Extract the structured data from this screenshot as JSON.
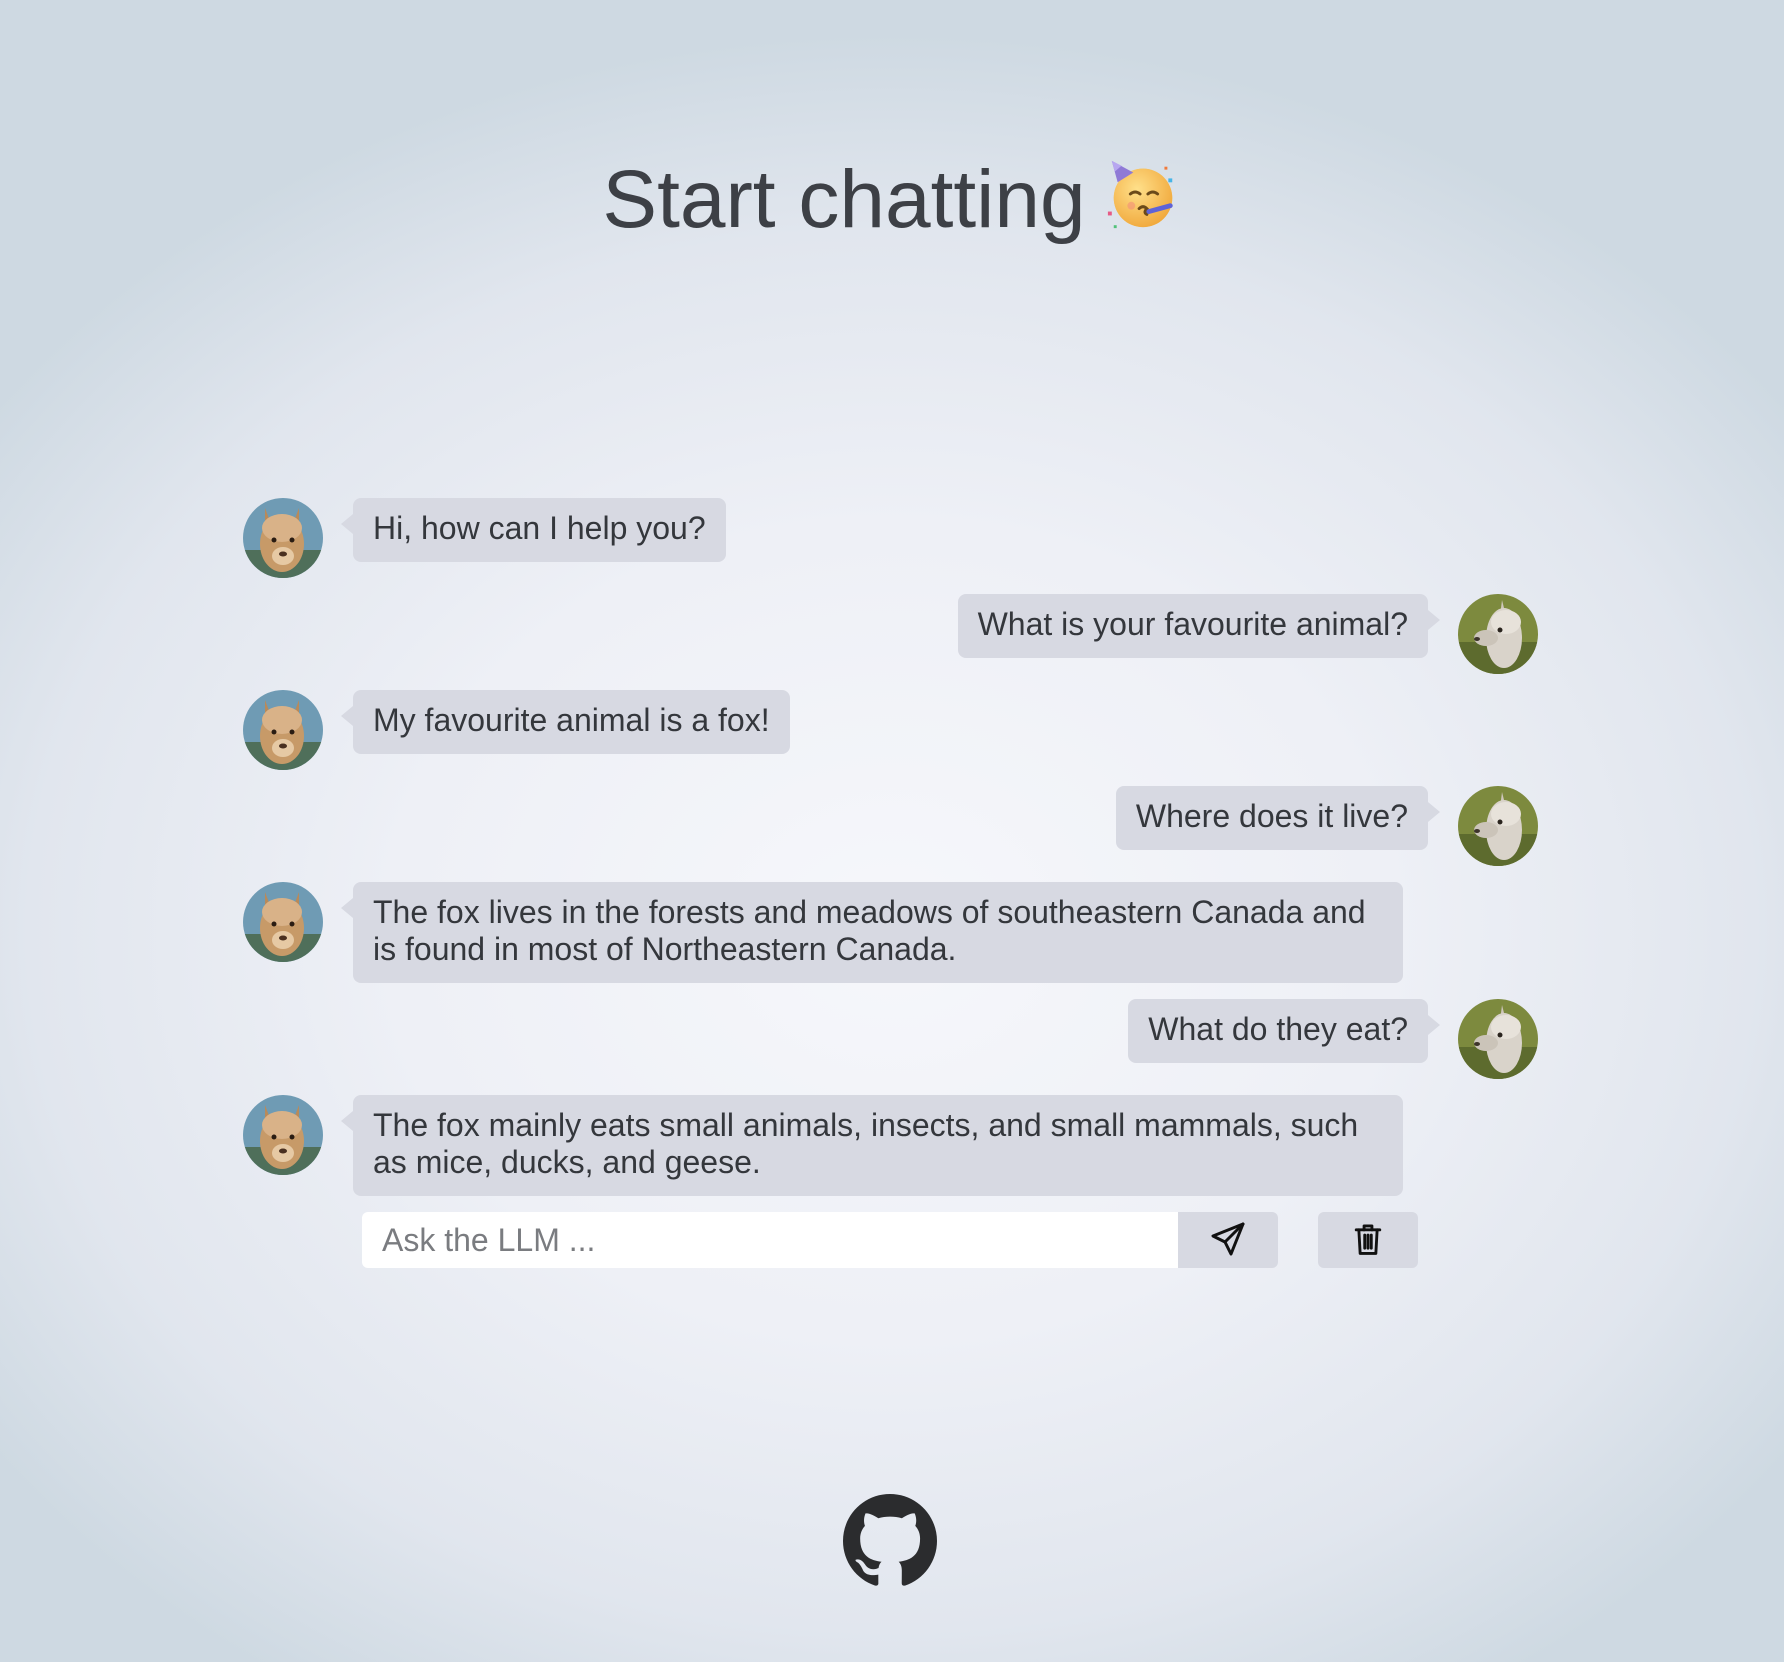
{
  "page": {
    "title": "Start chatting",
    "title_emoji": "partying-face-emoji"
  },
  "chat": {
    "messages": [
      {
        "role": "assistant",
        "avatar": "alpaca-brown-icon",
        "text": "Hi, how can I help you?"
      },
      {
        "role": "user",
        "avatar": "alpaca-grey-icon",
        "text": "What is your favourite animal?"
      },
      {
        "role": "assistant",
        "avatar": "alpaca-brown-icon",
        "text": "My favourite animal is a fox!"
      },
      {
        "role": "user",
        "avatar": "alpaca-grey-icon",
        "text": "Where does it live?"
      },
      {
        "role": "assistant",
        "avatar": "alpaca-brown-icon",
        "text": "The fox lives in the forests and meadows of southeastern Canada and is found in most of Northeastern Canada."
      },
      {
        "role": "user",
        "avatar": "alpaca-grey-icon",
        "text": "What do they eat?"
      },
      {
        "role": "assistant",
        "avatar": "alpaca-brown-icon",
        "text": "The fox mainly eats small animals, insects, and small mammals, such as mice, ducks, and geese."
      }
    ]
  },
  "input": {
    "placeholder": "Ask the LLM ...",
    "value": "",
    "send_icon": "paper-plane-icon",
    "clear_icon": "trash-icon"
  },
  "footer": {
    "icon": "github-icon"
  },
  "colors": {
    "bubble": "#d7d9e2",
    "title": "#3d4046",
    "background_center": "#f6f7fb",
    "background_edge": "#ced9e2"
  }
}
